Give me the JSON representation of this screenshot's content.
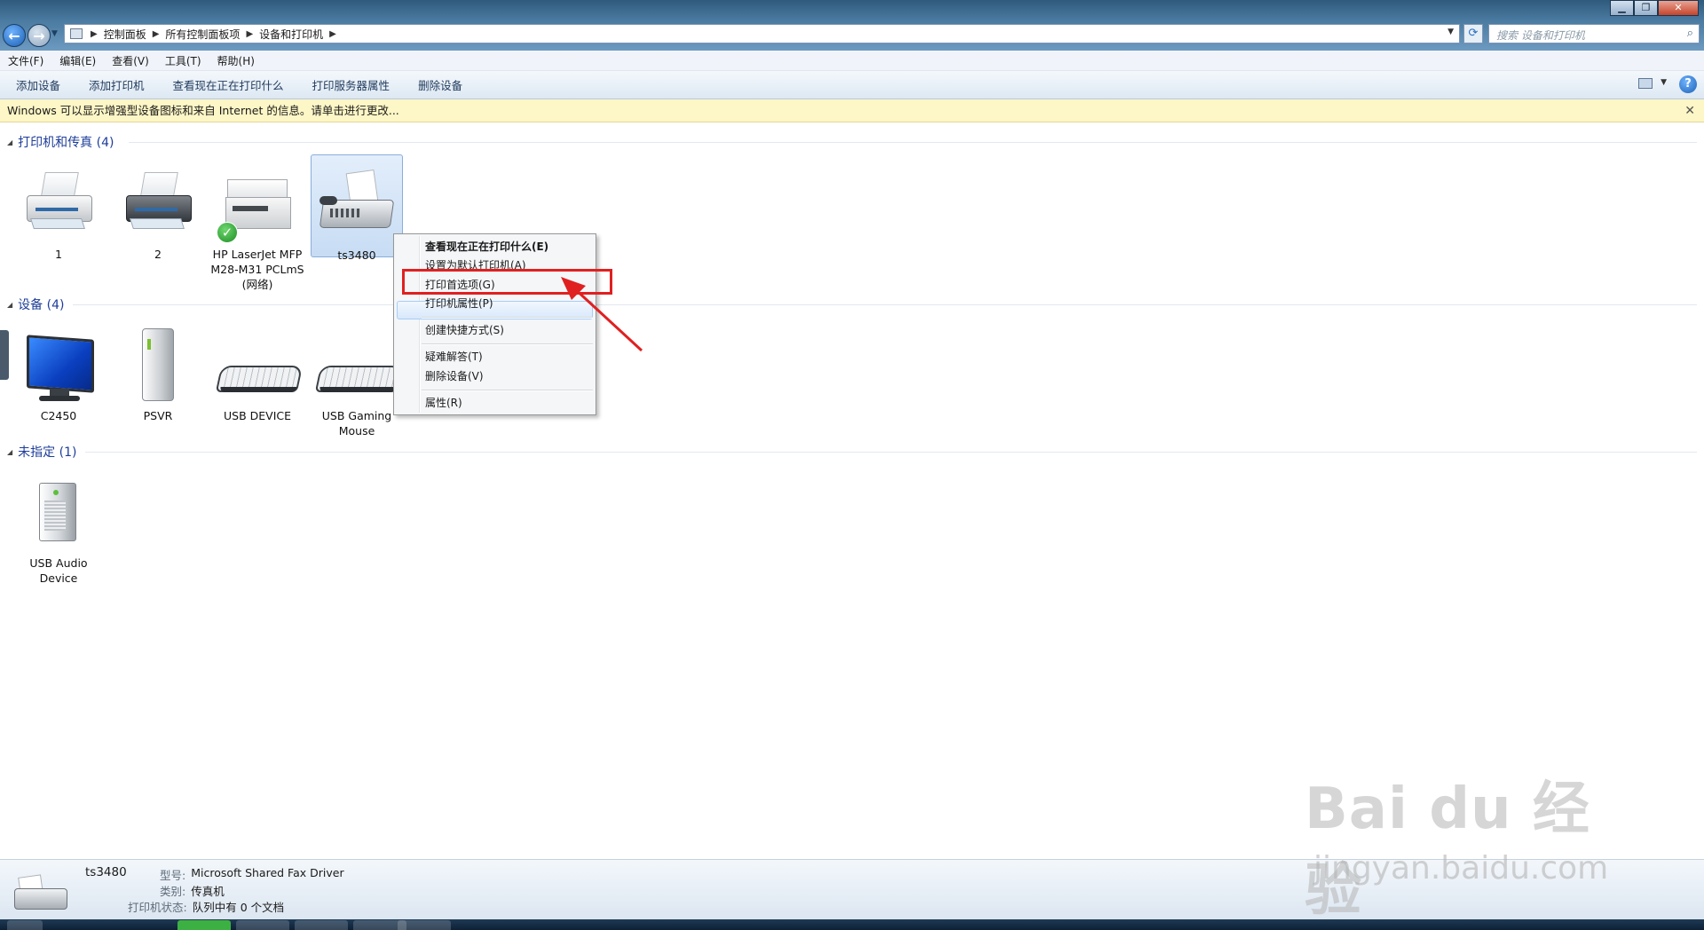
{
  "address_bar": {
    "crumbs": [
      "控制面板",
      "所有控制面板项",
      "设备和打印机"
    ],
    "search_placeholder": "搜索 设备和打印机"
  },
  "menu": {
    "items": [
      "文件(F)",
      "编辑(E)",
      "查看(V)",
      "工具(T)",
      "帮助(H)"
    ]
  },
  "toolbar": {
    "commands": [
      "添加设备",
      "添加打印机",
      "查看现在正在打印什么",
      "打印服务器属性",
      "删除设备"
    ]
  },
  "info_bar": {
    "text": "Windows 可以显示增强型设备图标和来自 Internet 的信息。请单击进行更改..."
  },
  "groups": {
    "printers": {
      "title": "打印机和传真 (4)",
      "items": [
        {
          "label": "1",
          "icon": "inkjet-printer-icon"
        },
        {
          "label": "2",
          "icon": "inkjet-printer-dark-icon"
        },
        {
          "label": "HP LaserJet MFP M28-M31 PCLmS (网络)",
          "icon": "laser-mfp-icon",
          "default": true
        },
        {
          "label": "ts3480",
          "icon": "fax-icon",
          "selected": true
        }
      ]
    },
    "devices": {
      "title": "设备 (4)",
      "items": [
        {
          "label": "C2450",
          "icon": "monitor-icon"
        },
        {
          "label": "PSVR",
          "icon": "tower-icon"
        },
        {
          "label": "USB DEVICE",
          "icon": "keyboard-icon"
        },
        {
          "label": "USB Gaming Mouse",
          "icon": "keyboard-icon"
        }
      ]
    },
    "unspecified": {
      "title": "未指定 (1)",
      "items": [
        {
          "label": "USB Audio Device",
          "icon": "audio-box-icon"
        }
      ]
    }
  },
  "context_menu": {
    "items": [
      {
        "label": "查看现在正在打印什么(E)",
        "bold": true
      },
      {
        "label": "设置为默认打印机(A)"
      },
      {
        "label": "打印首选项(G)",
        "highlighted": true
      },
      {
        "label": "打印机属性(P)"
      },
      {
        "label": "创建快捷方式(S)"
      },
      {
        "label": "疑难解答(T)"
      },
      {
        "label": "删除设备(V)"
      },
      {
        "label": "属性(R)"
      }
    ]
  },
  "details": {
    "name": "ts3480",
    "model_key": "型号:",
    "model_value": "Microsoft Shared Fax Driver",
    "category_key": "类别:",
    "category_value": "传真机",
    "status_key": "打印机状态:",
    "status_value": "队列中有 0 个文档"
  },
  "watermark": {
    "brand": "Bai du 经验",
    "url": "jingyan.baidu.com"
  },
  "colors": {
    "annotation_box": "#e02020",
    "annotation_arrow": "#e02020",
    "selection": "#c7dcf4",
    "group_title": "#1e3d99"
  }
}
